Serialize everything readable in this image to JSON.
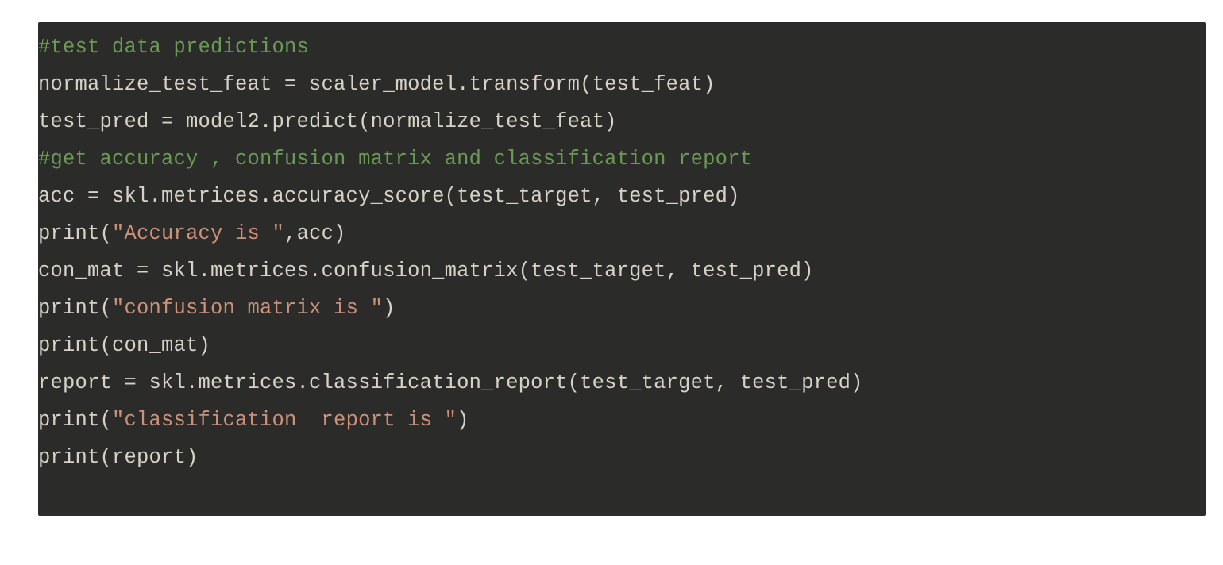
{
  "code": {
    "lines": [
      {
        "tokens": [
          {
            "type": "comment",
            "text": "#test data predictions"
          }
        ]
      },
      {
        "tokens": [
          {
            "type": "default",
            "text": "normalize_test_feat = scaler_model.transform(test_feat)"
          }
        ]
      },
      {
        "tokens": [
          {
            "type": "default",
            "text": "test_pred = model2.predict(normalize_test_feat)"
          }
        ]
      },
      {
        "tokens": [
          {
            "type": "comment",
            "text": "#get accuracy , confusion matrix and classification report"
          }
        ]
      },
      {
        "tokens": [
          {
            "type": "default",
            "text": "acc = skl.metrices.accuracy_score(test_target, test_pred)"
          }
        ]
      },
      {
        "tokens": [
          {
            "type": "default",
            "text": "print("
          },
          {
            "type": "string",
            "text": "\"Accuracy is \""
          },
          {
            "type": "default",
            "text": ",acc)"
          }
        ]
      },
      {
        "tokens": [
          {
            "type": "default",
            "text": "con_mat = skl.metrices.confusion_matrix(test_target, test_pred)"
          }
        ]
      },
      {
        "tokens": [
          {
            "type": "default",
            "text": "print("
          },
          {
            "type": "string",
            "text": "\"confusion matrix is \""
          },
          {
            "type": "default",
            "text": ")"
          }
        ]
      },
      {
        "tokens": [
          {
            "type": "default",
            "text": "print(con_mat)"
          }
        ]
      },
      {
        "tokens": [
          {
            "type": "default",
            "text": "report = skl.metrices.classification_report(test_target, test_pred)"
          }
        ]
      },
      {
        "tokens": [
          {
            "type": "default",
            "text": "print("
          },
          {
            "type": "string",
            "text": "\"classification  report is \""
          },
          {
            "type": "default",
            "text": ")"
          }
        ]
      },
      {
        "tokens": [
          {
            "type": "default",
            "text": "print(report)"
          }
        ]
      }
    ]
  },
  "token_classes": {
    "comment": "tok-comment",
    "default": "tok-default",
    "string": "tok-string"
  }
}
